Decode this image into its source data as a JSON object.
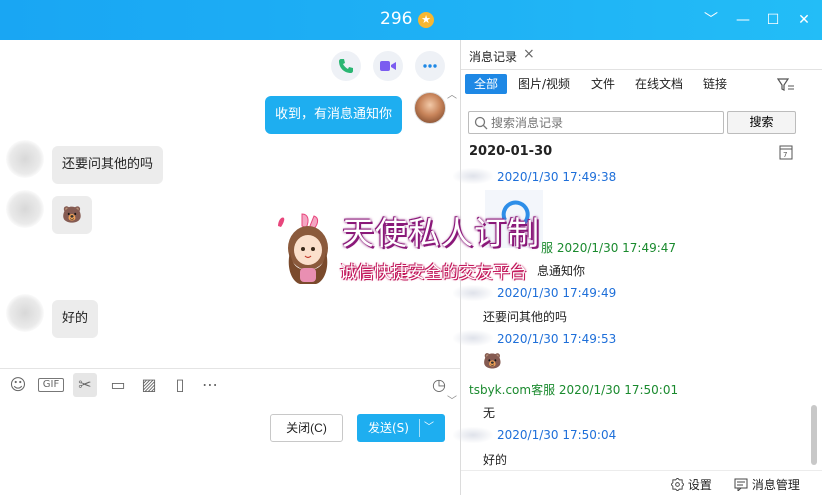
{
  "window": {
    "title": "296",
    "badge": "★",
    "controls": {
      "dropdown": "﹀",
      "minimize": "—",
      "maximize": "☐",
      "close": "✕"
    }
  },
  "chat": {
    "messages": [
      {
        "side": "out",
        "text": "收到，有消息通知你"
      },
      {
        "side": "in",
        "text": "还要问其他的吗"
      },
      {
        "side": "in",
        "text": "🐻"
      },
      {
        "side": "in",
        "text": "好的"
      }
    ],
    "buttons": {
      "close": "关闭(C)",
      "send": "发送(S)"
    }
  },
  "history": {
    "tab_label": "消息记录",
    "filters": [
      "全部",
      "图片/视频",
      "文件",
      "在线文档",
      "链接"
    ],
    "search_placeholder": "搜索消息记录",
    "search_button": "搜索",
    "date": "2020-01-30",
    "records": [
      {
        "meta": "2020/1/30 17:49:38",
        "color": "blue",
        "body": ""
      },
      {
        "meta": "服 2020/1/30 17:49:47",
        "color": "green",
        "body": "息通知你"
      },
      {
        "meta": "2020/1/30 17:49:49",
        "color": "blue",
        "body": "还要问其他的吗"
      },
      {
        "meta": "2020/1/30 17:49:53",
        "color": "blue",
        "body": "🐻"
      },
      {
        "meta": "tsbyk.com客服 2020/1/30 17:50:01",
        "color": "green",
        "body": "无"
      },
      {
        "meta": "2020/1/30 17:50:04",
        "color": "blue",
        "body": "好的"
      }
    ],
    "footer": {
      "settings": "设置",
      "manage": "消息管理"
    }
  },
  "watermark": {
    "title": "天使私人订制",
    "subtitle": "诚信快捷安全的交友平台"
  },
  "colors": {
    "accent": "#1eaef0",
    "tab_active": "#1e88e5",
    "time_blue": "#1e6fd9",
    "time_green": "#1a8a2e"
  }
}
